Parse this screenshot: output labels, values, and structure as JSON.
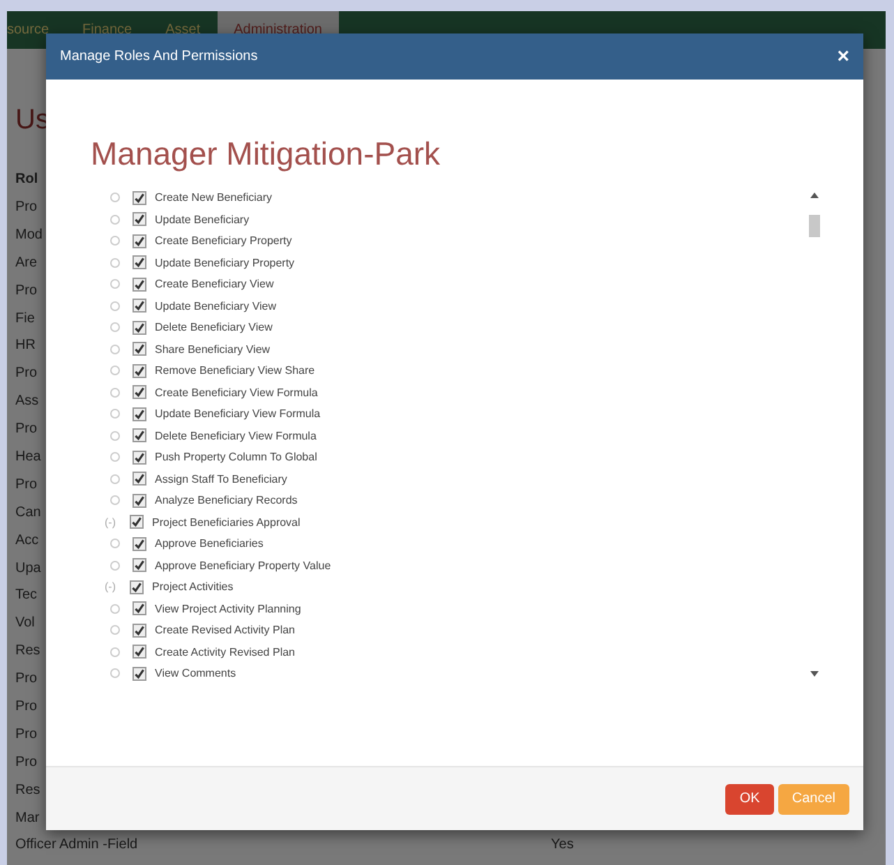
{
  "background": {
    "nav_tabs": [
      {
        "label": "source",
        "selected": false
      },
      {
        "label": "Finance",
        "selected": false
      },
      {
        "label": "Asset",
        "selected": false
      },
      {
        "label": "Administration",
        "selected": true
      }
    ],
    "heading": "Us",
    "table": {
      "header": "Rol",
      "rows": [
        {
          "column_1": "Pro"
        },
        {
          "column_1": "Mod"
        },
        {
          "column_1": "Are"
        },
        {
          "column_1": "Pro"
        },
        {
          "column_1": "Fie"
        },
        {
          "column_1": "HR"
        },
        {
          "column_1": "Pro"
        },
        {
          "column_1": "Ass"
        },
        {
          "column_1": "Pro"
        },
        {
          "column_1": "Hea"
        },
        {
          "column_1": "Pro"
        },
        {
          "column_1": "Can"
        },
        {
          "column_1": "Acc"
        },
        {
          "column_1": "Upa"
        },
        {
          "column_1": "Tec"
        },
        {
          "column_1": "Vol"
        },
        {
          "column_1": "Res"
        },
        {
          "column_1": "Pro"
        },
        {
          "column_1": "Pro"
        },
        {
          "column_1": "Pro"
        },
        {
          "column_1": "Pro"
        },
        {
          "column_1": "Res"
        },
        {
          "column_1": "Mar"
        },
        {
          "column_1": "Officer Admin -Field",
          "column_2": "Yes"
        }
      ]
    }
  },
  "modal": {
    "title": "Manage Roles And Permissions",
    "close": "×",
    "role_name": "Manager Mitigation-Park",
    "tree": [
      {
        "children": [
          {
            "label": "Create New Beneficiary",
            "checked": true
          },
          {
            "label": "Update Beneficiary",
            "checked": true
          },
          {
            "label": "Create Beneficiary Property",
            "checked": true
          },
          {
            "label": "Update Beneficiary Property",
            "checked": true
          },
          {
            "label": "Create Beneficiary View",
            "checked": true
          },
          {
            "label": "Update Beneficiary View",
            "checked": true
          },
          {
            "label": "Delete Beneficiary View",
            "checked": true
          },
          {
            "label": "Share Beneficiary View",
            "checked": true
          },
          {
            "label": "Remove Beneficiary View Share",
            "checked": true
          },
          {
            "label": "Create Beneficiary View Formula",
            "checked": true
          },
          {
            "label": "Update Beneficiary View Formula",
            "checked": true
          },
          {
            "label": "Delete Beneficiary View Formula",
            "checked": true
          },
          {
            "label": "Push Property Column To Global",
            "checked": true
          },
          {
            "label": "Assign Staff To Beneficiary",
            "checked": true
          },
          {
            "label": "Analyze Beneficiary Records",
            "checked": true
          }
        ]
      },
      {
        "label": "Project Beneficiaries Approval",
        "toggle": "(-)",
        "checked": true,
        "children": [
          {
            "label": "Approve Beneficiaries",
            "checked": true
          },
          {
            "label": "Approve Beneficiary Property Value",
            "checked": true
          }
        ]
      },
      {
        "label": "Project Activities",
        "toggle": "(-)",
        "checked": true,
        "children": [
          {
            "label": "View Project Activity Planning",
            "checked": true
          },
          {
            "label": "Create Revised Activity Plan",
            "checked": true
          },
          {
            "label": "Create Activity Revised Plan",
            "checked": true
          },
          {
            "label": "View Comments",
            "checked": true
          }
        ]
      }
    ],
    "buttons": [
      {
        "label": "OK",
        "kind": "primary"
      },
      {
        "label": "Cancel",
        "kind": "cancel"
      }
    ]
  }
}
